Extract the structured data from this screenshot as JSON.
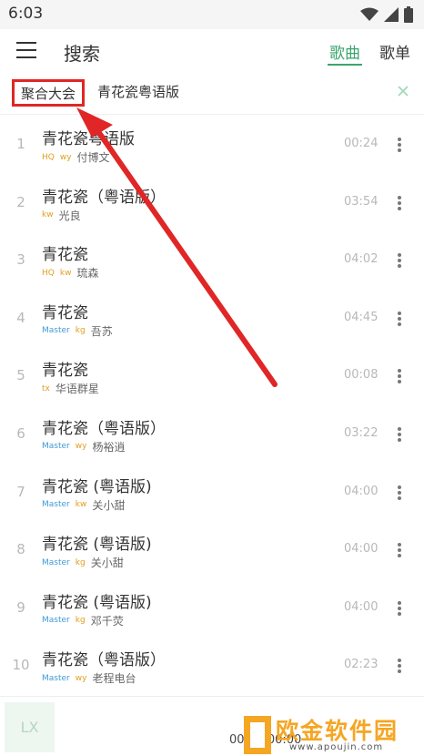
{
  "status": {
    "time": "6:03",
    "icons": [
      "wifi-icon",
      "signal-icon",
      "battery-icon"
    ]
  },
  "header": {
    "title": "搜索",
    "tabs": [
      {
        "label": "歌曲",
        "active": true
      },
      {
        "label": "歌单",
        "active": false
      }
    ]
  },
  "search": {
    "source": "聚合大会",
    "query": "青花瓷粤语版"
  },
  "songs": [
    {
      "index": "1",
      "name": "青花瓷粤语版",
      "badges": [
        "HQ",
        "wy"
      ],
      "artist": "付博文",
      "duration": "00:24"
    },
    {
      "index": "2",
      "name": "青花瓷（粤语版）",
      "badges": [
        "kw"
      ],
      "artist": "光良",
      "duration": "03:54"
    },
    {
      "index": "3",
      "name": "青花瓷",
      "badges": [
        "HQ",
        "kw"
      ],
      "artist": "琉森",
      "duration": "04:02"
    },
    {
      "index": "4",
      "name": "青花瓷",
      "badges": [
        "Master",
        "kg"
      ],
      "artist": "吾苏",
      "duration": "04:45"
    },
    {
      "index": "5",
      "name": "青花瓷",
      "badges": [
        "tx"
      ],
      "artist": "华语群星",
      "duration": "00:08"
    },
    {
      "index": "6",
      "name": "青花瓷（粤语版）",
      "badges": [
        "Master",
        "wy"
      ],
      "artist": "杨裕逍",
      "duration": "03:22"
    },
    {
      "index": "7",
      "name": "青花瓷 (粤语版)",
      "badges": [
        "Master",
        "kw"
      ],
      "artist": "关小甜",
      "duration": "04:00"
    },
    {
      "index": "8",
      "name": "青花瓷 (粤语版)",
      "badges": [
        "Master",
        "kg"
      ],
      "artist": "关小甜",
      "duration": "04:00"
    },
    {
      "index": "9",
      "name": "青花瓷 (粤语版)",
      "badges": [
        "Master",
        "kg"
      ],
      "artist": "邓千荧",
      "duration": "04:00"
    },
    {
      "index": "10",
      "name": "青花瓷（粤语版）",
      "badges": [
        "Master",
        "wy"
      ],
      "artist": "老程电台",
      "duration": "02:23"
    }
  ],
  "player": {
    "logo": "LX",
    "time": "00:00/00:00"
  },
  "watermark": {
    "text": "欧金软件园",
    "url": "www.apoujin.com"
  },
  "colors": {
    "accent": "#3aa56f",
    "highlight": "#e02626",
    "badge_blue": "#3e9ad6",
    "badge_orange": "#e29d1f"
  }
}
